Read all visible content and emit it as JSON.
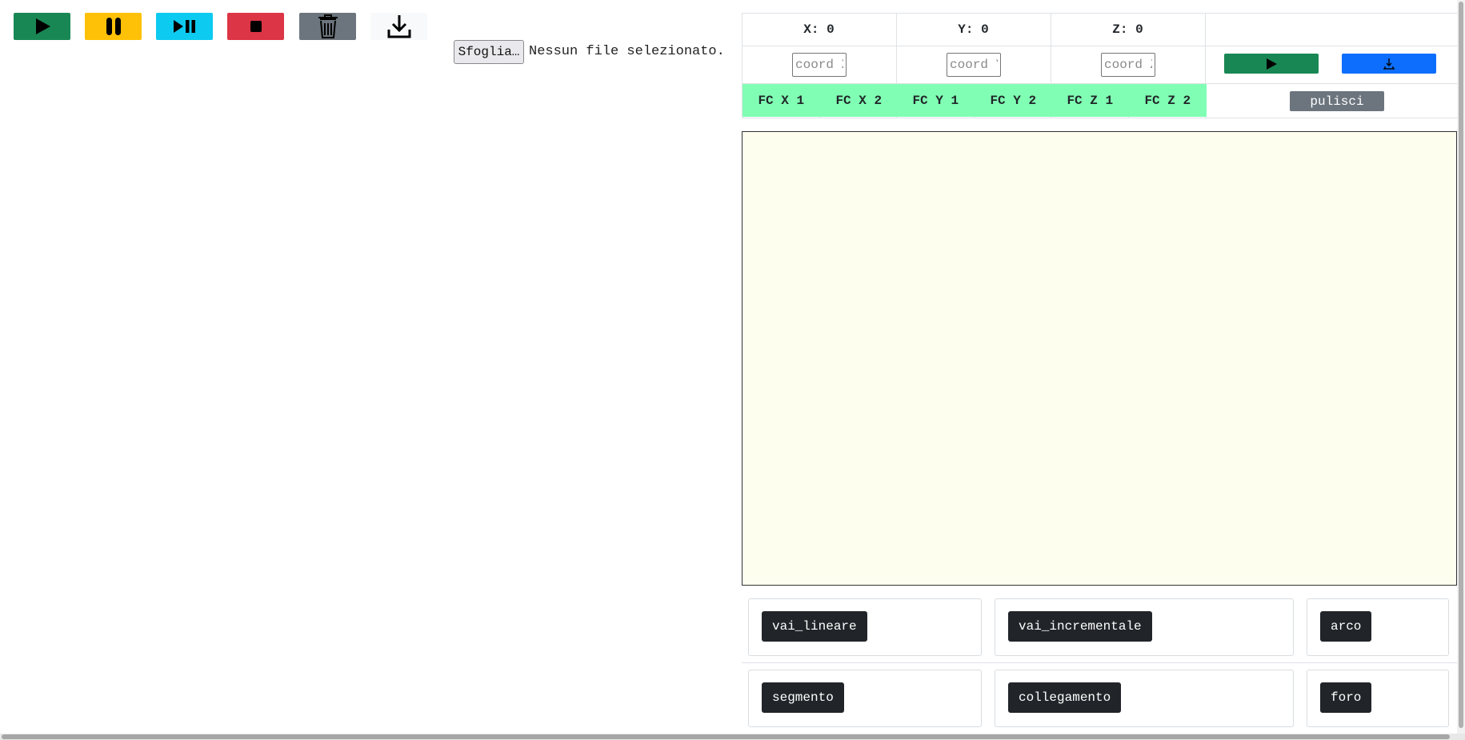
{
  "toolbar": {
    "buttons": [
      {
        "name": "play-button",
        "icon": "play-icon",
        "color": "#198754"
      },
      {
        "name": "pause-button",
        "icon": "pause-icon",
        "color": "#ffc107"
      },
      {
        "name": "step-button",
        "icon": "play-pause-icon",
        "color": "#0dcaf0"
      },
      {
        "name": "stop-button",
        "icon": "stop-icon",
        "color": "#dc3545"
      },
      {
        "name": "delete-button",
        "icon": "trash-icon",
        "color": "#6c757d"
      },
      {
        "name": "download-button",
        "icon": "download-icon",
        "color": "#f8f9fa"
      }
    ]
  },
  "file_input": {
    "button_label": "Sfoglia…",
    "status": "Nessun file selezionato."
  },
  "coords": {
    "x_label": "X: 0",
    "y_label": "Y: 0",
    "z_label": "Z: 0",
    "x_placeholder": "coord X",
    "y_placeholder": "coord Y",
    "z_placeholder": "coord Z",
    "go_button_icon": "play-icon",
    "home_button_icon": "home-icon"
  },
  "limit_switches": [
    "FC X 1",
    "FC X 2",
    "FC Y 1",
    "FC Y 2",
    "FC Z 1",
    "FC Z 2"
  ],
  "clear_label": "pulisci",
  "colors": {
    "limit_switch_bg": "#80ffb4",
    "editor_bg": "#fefeef",
    "command_bg": "#212529",
    "go_green": "#198754",
    "home_blue": "#0d6efd"
  },
  "commands": {
    "vai_lineare": "vai_lineare",
    "vai_incrementale": "vai_incrementale",
    "arco": "arco",
    "segmento": "segmento",
    "collegamento": "collegamento",
    "foro": "foro"
  }
}
